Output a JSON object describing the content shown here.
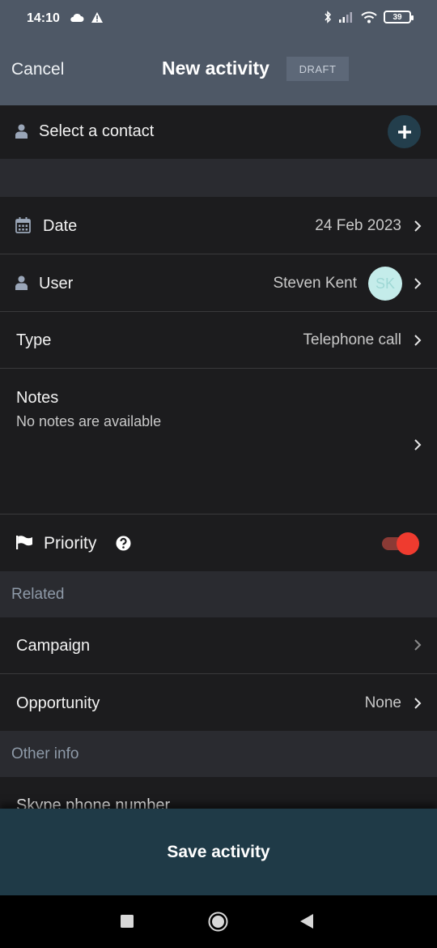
{
  "status_bar": {
    "time": "14:10",
    "battery": "39",
    "left_icons": [
      "cloud-icon",
      "warning-icon"
    ],
    "right_icons": [
      "bluetooth-icon",
      "signal-icon",
      "wifi-icon",
      "battery-icon"
    ]
  },
  "header": {
    "cancel_label": "Cancel",
    "title": "New activity",
    "badge": "DRAFT"
  },
  "contact": {
    "label": "Select a contact"
  },
  "fields": {
    "date": {
      "label": "Date",
      "value": "24 Feb 2023"
    },
    "user": {
      "label": "User",
      "value": "Steven Kent",
      "avatar_initials": "SK"
    },
    "type": {
      "label": "Type",
      "value": "Telephone call"
    },
    "notes": {
      "label": "Notes",
      "value": "No notes are available"
    },
    "priority": {
      "label": "Priority",
      "enabled": true
    }
  },
  "related": {
    "section_label": "Related",
    "campaign": {
      "label": "Campaign"
    },
    "opportunity": {
      "label": "Opportunity",
      "value": "None"
    }
  },
  "other_info": {
    "section_label": "Other info",
    "skype": {
      "label": "Skype phone number"
    }
  },
  "save_button": {
    "label": "Save activity"
  },
  "nav": [
    "recents-icon",
    "home-icon",
    "back-icon"
  ],
  "colors": {
    "header_bg": "#4e5866",
    "accent": "#1f3a47",
    "toggle_on": "#ef3b2f"
  }
}
